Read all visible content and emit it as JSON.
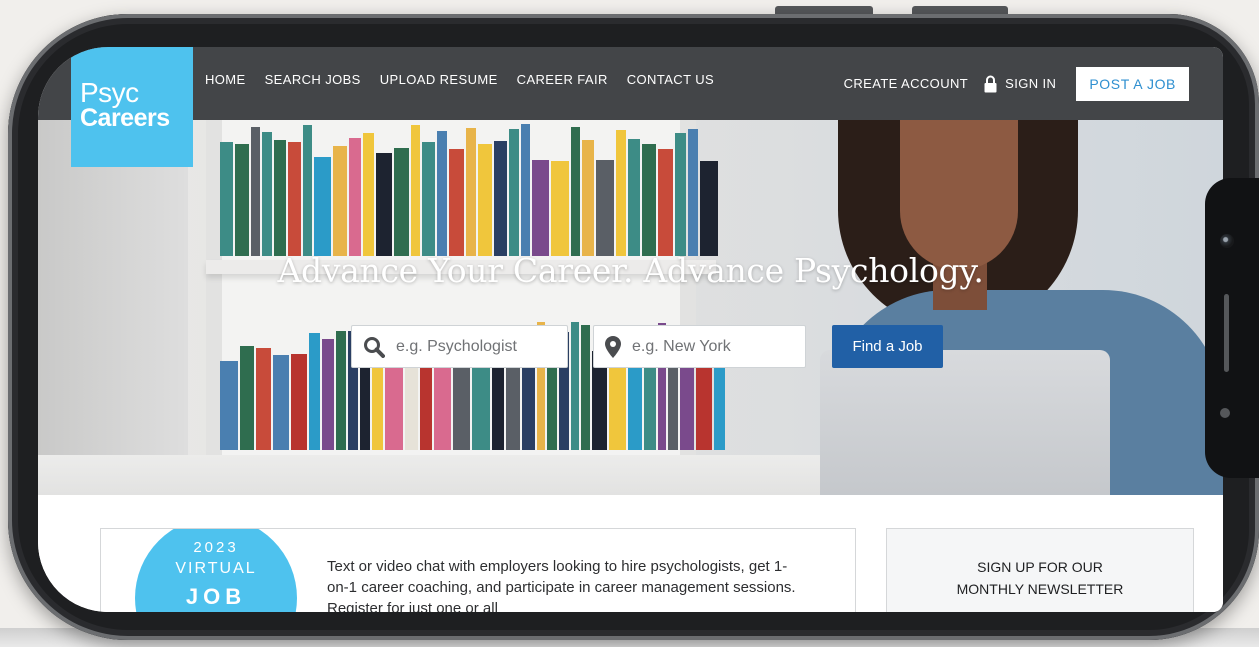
{
  "header": {
    "logo_line1": "Psyc",
    "logo_line2": "Careers",
    "nav": [
      "HOME",
      "SEARCH JOBS",
      "UPLOAD RESUME",
      "CAREER FAIR",
      "CONTACT US"
    ],
    "create_account": "CREATE ACCOUNT",
    "sign_in": "SIGN IN",
    "post_job": "POST A JOB"
  },
  "hero": {
    "title": "Advance Your Career. Advance Psychology.",
    "keyword_placeholder": "e.g. Psychologist",
    "location_placeholder": "e.g. New York",
    "find_button": "Find a Job"
  },
  "event": {
    "year": "2023",
    "line2": "VIRTUAL",
    "line3": "JOB",
    "text": "Text or video chat with employers looking to hire psychologists, get 1-on-1 career coaching, and participate in career management sessions. Register for just one or all"
  },
  "newsletter": {
    "line1": "SIGN UP FOR OUR",
    "line2": "MONTHLY NEWSLETTER"
  },
  "colors": {
    "brand_blue": "#4ec2ee",
    "nav_bg": "#434548",
    "button_blue": "#2160a6"
  }
}
